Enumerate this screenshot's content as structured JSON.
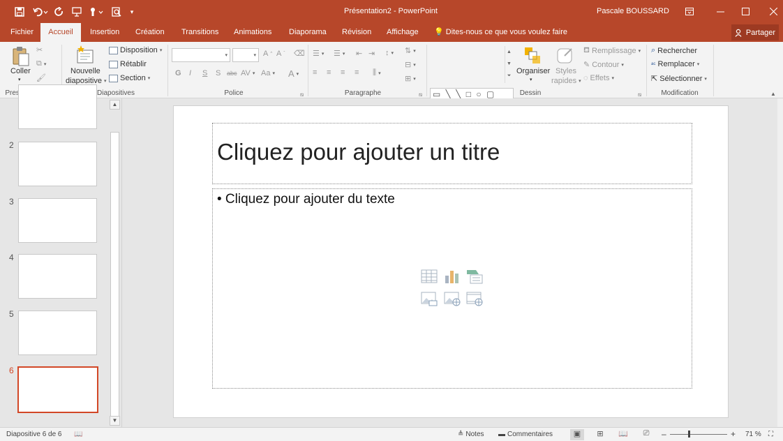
{
  "titlebar": {
    "doc_title": "Présentation2 - PowerPoint",
    "user_name": "Pascale BOUSSARD",
    "icons": [
      "save-icon",
      "undo-icon",
      "redo-icon",
      "start-from-beginning-icon",
      "touch-mode-icon",
      "print-preview-icon",
      "customize-qat-icon"
    ],
    "window_icons": [
      "ribbon-display-icon",
      "minimize-icon",
      "maximize-icon",
      "close-icon"
    ]
  },
  "tabs": [
    "Fichier",
    "Accueil",
    "Insertion",
    "Création",
    "Transitions",
    "Animations",
    "Diaporama",
    "Révision",
    "Affichage"
  ],
  "active_tab": "Accueil",
  "tell_me": "Dites-nous ce que vous voulez faire",
  "share": "Partager",
  "ribbon": {
    "clipboard": {
      "paste": "Coller",
      "label": "Presse-papiers"
    },
    "slides": {
      "new_slide_1": "Nouvelle",
      "new_slide_2": "diapositive",
      "layout": "Disposition",
      "reset": "Rétablir",
      "section": "Section",
      "label": "Diapositives"
    },
    "font": {
      "label": "Police",
      "bold": "G",
      "italic": "I",
      "underline": "S",
      "shadow": "S",
      "strike": "abc",
      "spacing": "AV",
      "case": "Aa",
      "color": "A"
    },
    "paragraph": {
      "label": "Paragraphe"
    },
    "drawing": {
      "arrange": "Organiser",
      "styles_1": "Styles",
      "styles_2": "rapides",
      "fill": "Remplissage",
      "outline": "Contour",
      "effects": "Effets",
      "label": "Dessin"
    },
    "editing": {
      "find": "Rechercher",
      "replace": "Remplacer",
      "select": "Sélectionner",
      "label": "Modification"
    }
  },
  "thumbnails": [
    {
      "number": "",
      "selected": false
    },
    {
      "number": "2",
      "selected": false
    },
    {
      "number": "3",
      "selected": false
    },
    {
      "number": "4",
      "selected": false
    },
    {
      "number": "5",
      "selected": false
    },
    {
      "number": "6",
      "selected": true
    }
  ],
  "slide": {
    "title_placeholder": "Cliquez pour ajouter un titre",
    "body_placeholder": "• Cliquez pour ajouter du texte",
    "insert_icons": [
      "insert-table-icon",
      "insert-chart-icon",
      "insert-smartart-icon",
      "insert-picture-icon",
      "insert-online-picture-icon",
      "insert-video-icon"
    ]
  },
  "status": {
    "slide_info": "Diapositive 6 de 6",
    "notes": "Notes",
    "comments": "Commentaires",
    "zoom": "71 %",
    "zoom_level_percent": 71
  }
}
